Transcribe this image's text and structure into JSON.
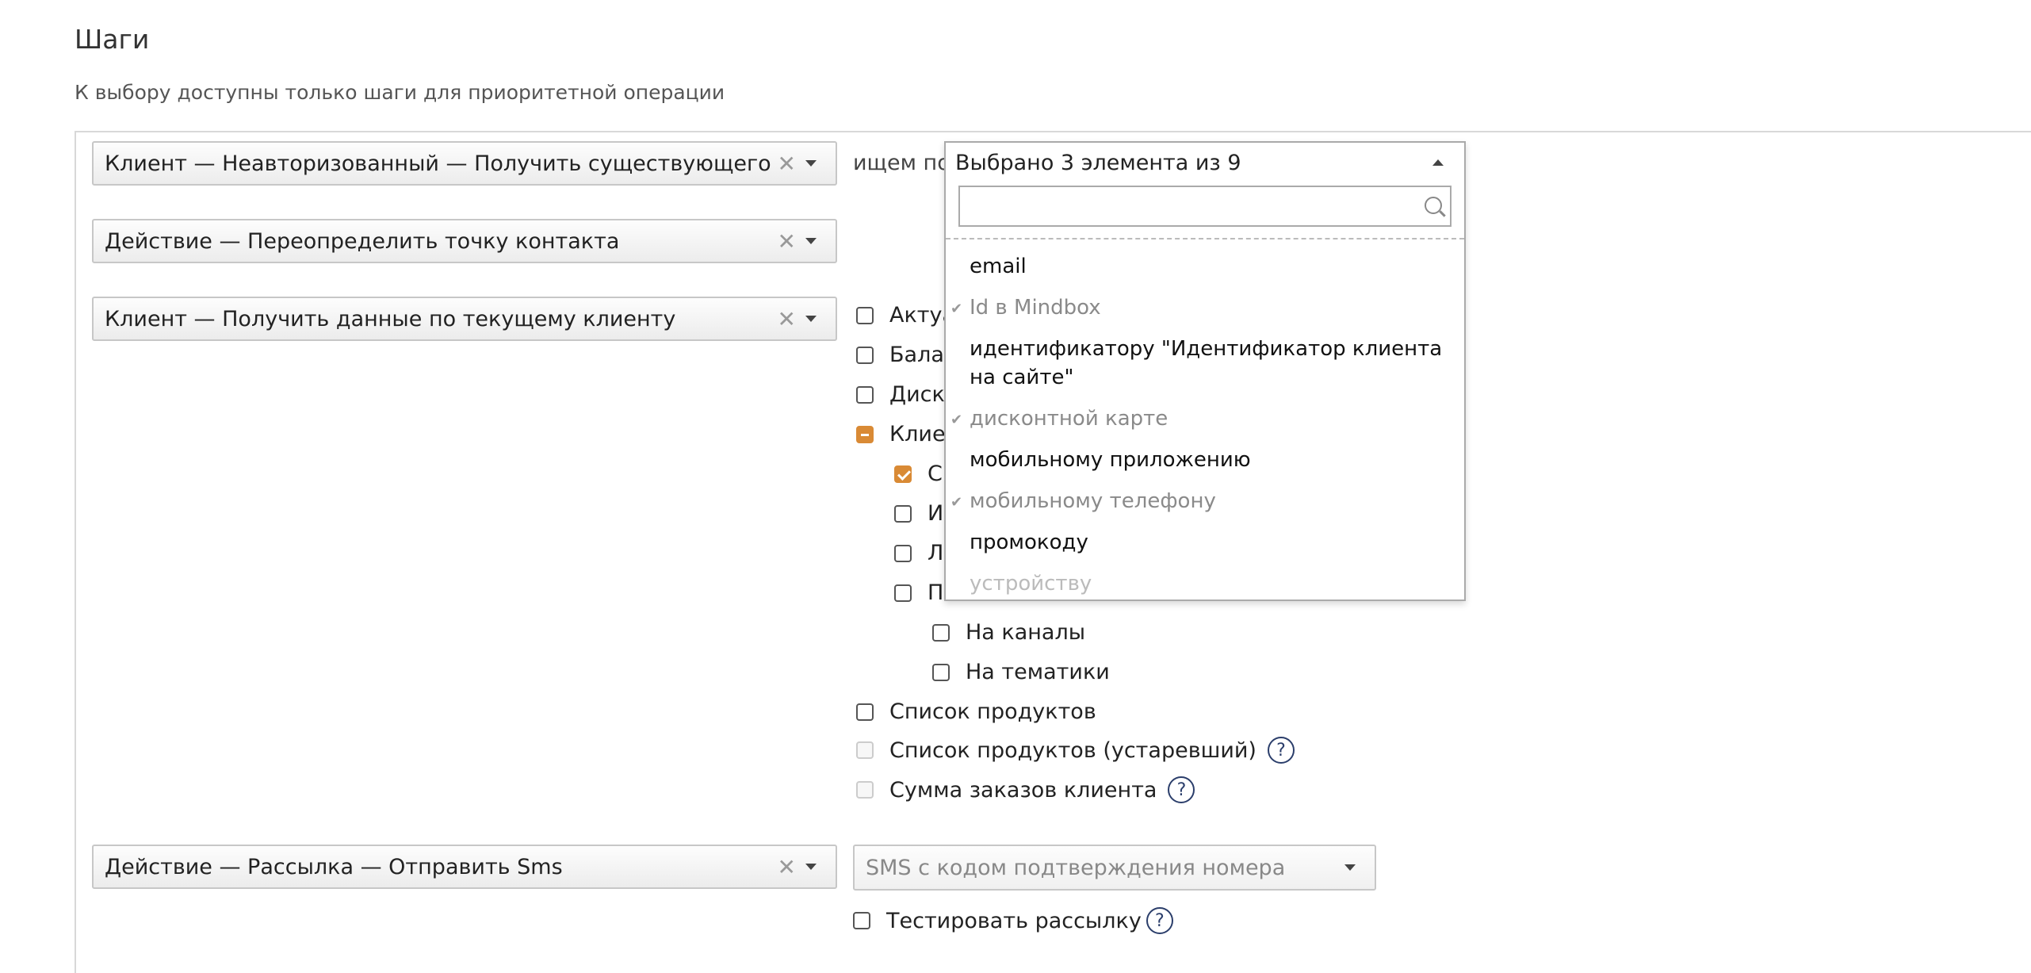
{
  "header": {
    "title": "Шаги",
    "subtitle": "К выбору доступны только шаги для приоритетной операции"
  },
  "steps": [
    {
      "label": "Клиент — Неавторизованный — Получить существующего"
    },
    {
      "label": "Действие — Переопределить точку контакта"
    },
    {
      "label": "Клиент — Получить данные по текущему клиенту"
    },
    {
      "label": "Действие — Рассылка — Отправить Sms"
    }
  ],
  "search_by": {
    "label": "ищем по",
    "summary": "Выбрано 3 элемента из 9",
    "search_placeholder": "",
    "options": [
      {
        "label": "email",
        "state": "normal"
      },
      {
        "label": "Id в Mindbox",
        "state": "selected"
      },
      {
        "label": "идентификатору \"Идентификатор клиента на сайте\"",
        "state": "normal"
      },
      {
        "label": "дисконтной карте",
        "state": "selected"
      },
      {
        "label": "мобильному приложению",
        "state": "normal"
      },
      {
        "label": "мобильному телефону",
        "state": "selected"
      },
      {
        "label": "промокоду",
        "state": "normal"
      },
      {
        "label": "устройству",
        "state": "disabled"
      }
    ]
  },
  "client_data_options": [
    {
      "label": "Актуа",
      "state": "unchecked"
    },
    {
      "label": "Балан",
      "state": "unchecked"
    },
    {
      "label": "Диско",
      "state": "unchecked"
    },
    {
      "label": "Клиен",
      "state": "partial"
    },
    {
      "label": "С",
      "state": "checked"
    },
    {
      "label": "И",
      "state": "unchecked"
    },
    {
      "label": "Л",
      "state": "unchecked"
    },
    {
      "label": "П",
      "state": "unchecked"
    },
    {
      "label": "На каналы",
      "state": "unchecked"
    },
    {
      "label": "На тематики",
      "state": "unchecked"
    },
    {
      "label": "Список продуктов",
      "state": "unchecked"
    },
    {
      "label": "Список продуктов (устаревший)",
      "state": "disabled",
      "help": "?"
    },
    {
      "label": "Сумма заказов клиента",
      "state": "disabled",
      "help": "?"
    }
  ],
  "sms": {
    "template_value": "SMS с кодом подтверждения номера",
    "test_label": "Тестировать рассылку",
    "help": "?"
  },
  "icons": {
    "clear": "close-icon",
    "caret": "chevron-down-icon",
    "search": "search-icon",
    "help": "help-circle-icon",
    "check": "check-icon"
  },
  "colors": {
    "accent": "#d98a35",
    "help": "#2b3e6b"
  }
}
